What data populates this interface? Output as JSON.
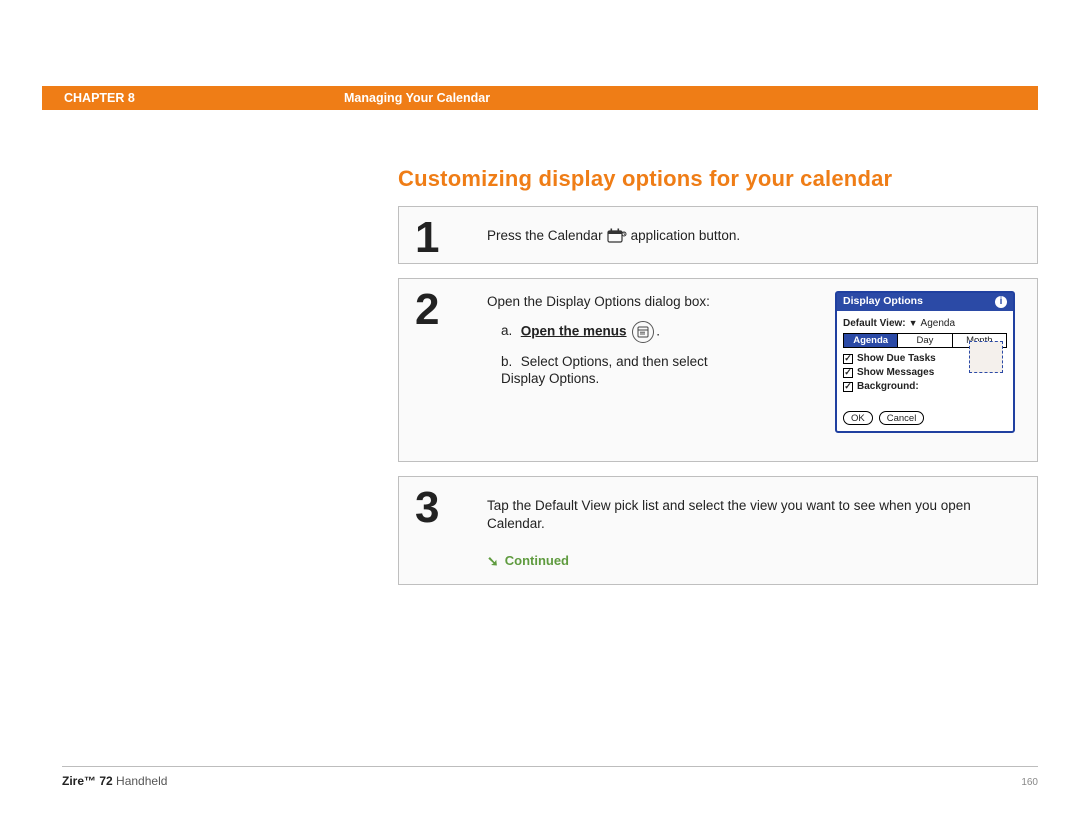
{
  "header": {
    "chapter": "CHAPTER 8",
    "section": "Managing Your Calendar"
  },
  "title": "Customizing display options for your calendar",
  "steps": {
    "s1": {
      "num": "1",
      "pre": "Press the Calendar",
      "post": " application button."
    },
    "s2": {
      "num": "2",
      "intro": "Open the Display Options dialog box:",
      "a_label": "a.",
      "a_link": "Open the menus",
      "a_period": ".",
      "b_label": "b.",
      "b_text": "Select Options, and then select Display Options."
    },
    "s3": {
      "num": "3",
      "text": "Tap the Default View pick list and select the view you want to see when you open Calendar.",
      "continued": "Continued"
    }
  },
  "dialog": {
    "title": "Display Options",
    "default_view_label": "Default View:",
    "default_view_value": "Agenda",
    "tabs": {
      "agenda": "Agenda",
      "day": "Day",
      "month": "Month"
    },
    "chk_tasks": "Show Due Tasks",
    "chk_msgs": "Show Messages",
    "chk_bg": "Background:",
    "ok": "OK",
    "cancel": "Cancel"
  },
  "footer": {
    "product_bold": "Zire™ 72",
    "product_rest": " Handheld",
    "page": "160"
  }
}
